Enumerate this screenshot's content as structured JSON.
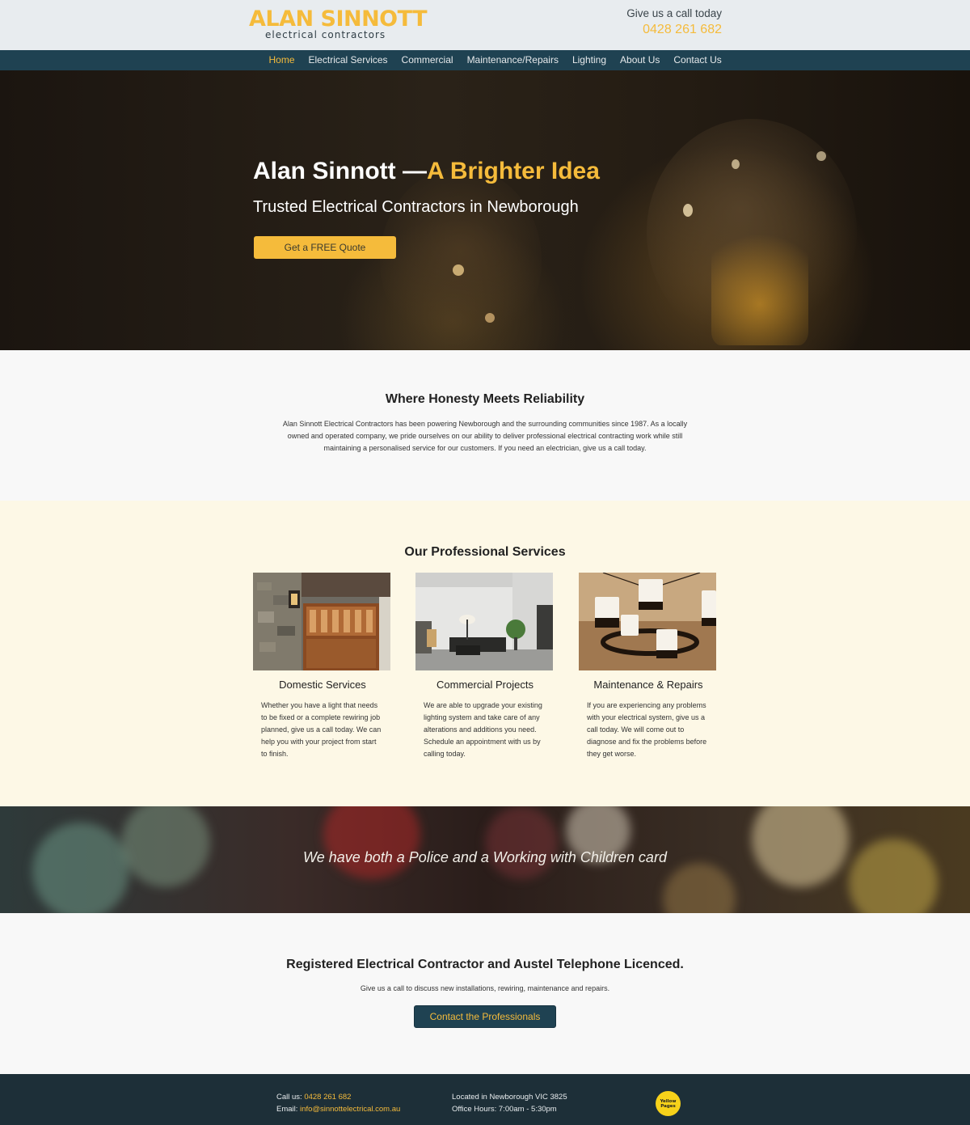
{
  "header": {
    "logo_main": "ALAN SINNOTT",
    "logo_sub": "electrical contractors",
    "call_label": "Give us a call today",
    "phone": "0428 261 682"
  },
  "nav": {
    "items": [
      {
        "label": "Home",
        "active": true
      },
      {
        "label": "Electrical Services",
        "active": false
      },
      {
        "label": "Commercial",
        "active": false
      },
      {
        "label": "Maintenance/Repairs",
        "active": false
      },
      {
        "label": "Lighting",
        "active": false
      },
      {
        "label": "About Us",
        "active": false
      },
      {
        "label": "Contact Us",
        "active": false
      }
    ]
  },
  "hero": {
    "title_main": "Alan Sinnott —",
    "title_accent": "A Brighter Idea",
    "subtitle": "Trusted Electrical Contractors in Newborough",
    "button": "Get a FREE Quote"
  },
  "intro": {
    "heading": "Where Honesty Meets Reliability",
    "text": "Alan Sinnott Electrical Contractors has been powering Newborough and the surrounding communities since 1987. As a locally owned and operated company, we pride ourselves on our ability to deliver professional electrical contracting work while still maintaining a personalised service for our customers. If you need an electrician, give us a call today."
  },
  "services": {
    "heading": "Our Professional Services",
    "cards": [
      {
        "title": "Domestic Services",
        "text": "Whether you have a light that needs to be fixed or a complete rewiring job planned, give us a call today. We can help you with your project from start to finish."
      },
      {
        "title": "Commercial Projects",
        "text": "We are able to upgrade your existing lighting system and take care of any alterations and additions you need. Schedule an appointment with us by calling today."
      },
      {
        "title": "Maintenance & Repairs",
        "text": "If you are experiencing any problems with your electrical system, give us a call today. We will come out to diagnose and fix the problems before they get worse."
      }
    ]
  },
  "banner": {
    "text": "We have both a Police and a Working with Children card"
  },
  "registered": {
    "heading": "Registered Electrical Contractor and Austel Telephone Licenced.",
    "text": "Give us a call to discuss new installations, rewiring, maintenance and repairs.",
    "button": "Contact the Professionals"
  },
  "footer": {
    "call_label": "Call us:",
    "phone": "0428 261 682",
    "email_label": "Email:",
    "email": "info@sinnottelectrical.com.au",
    "location": "Located in Newborough VIC 3825",
    "hours": "Office Hours: 7:00am - 5:30pm",
    "badge_line1": "Yellow",
    "badge_line2": "Pages"
  },
  "colors": {
    "accent": "#f5bb3b",
    "nav_bg": "#1f4252",
    "footer_bg": "#1d2f38",
    "services_bg": "#fdf8e6"
  }
}
